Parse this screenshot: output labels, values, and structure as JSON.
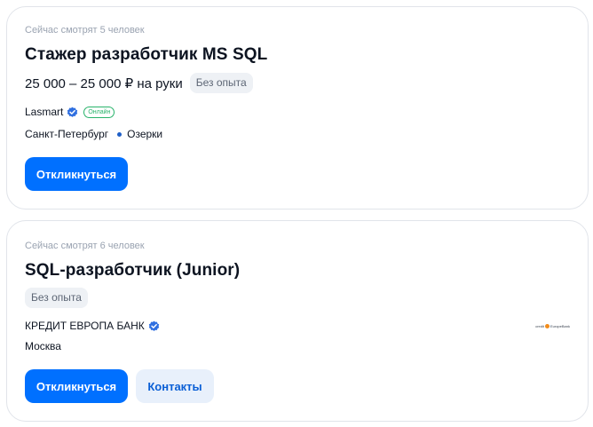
{
  "vacancies": [
    {
      "viewers": "Сейчас смотрят 5 человек",
      "title": "Стажер разработчик MS SQL",
      "salary": "25 000 – 25 000 ₽ на руки",
      "experience": "Без опыта",
      "company": "Lasmart",
      "online_badge": "Онлайн",
      "city": "Санкт-Петербург",
      "metro": "Озерки",
      "respond_label": "Откликнуться"
    },
    {
      "viewers": "Сейчас смотрят 6 человек",
      "title": "SQL-разработчик (Junior)",
      "experience": "Без опыта",
      "company": "КРЕДИТ ЕВРОПА БАНК",
      "logo_text_left": "credit",
      "logo_text_right": "EuropeBank",
      "city": "Москва",
      "respond_label": "Откликнуться",
      "contacts_label": "Контакты"
    }
  ],
  "colors": {
    "primary_button": "#0070ff",
    "secondary_button": "#e8f0fb",
    "verified": "#2f6fe0",
    "online": "#29b36b",
    "metro_line": "#1f5fc7"
  },
  "icons": [
    "verified-icon",
    "metro-line-icon"
  ]
}
